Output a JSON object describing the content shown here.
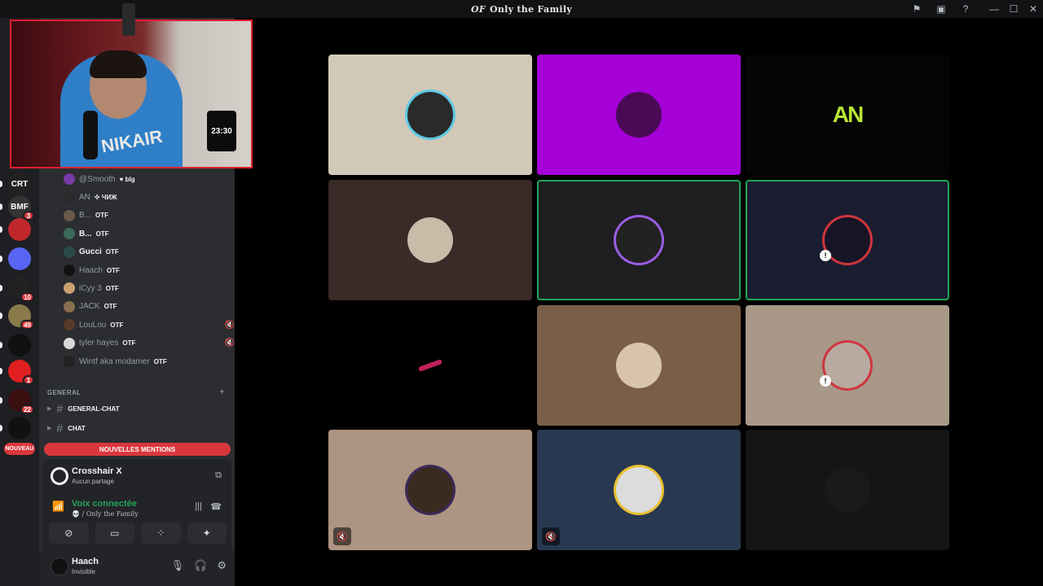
{
  "window": {
    "title": "Only the Family",
    "title_logo": "OF"
  },
  "colors": {
    "accent_red": "#da373c",
    "voice_green": "#23a559",
    "sidebar_bg": "#2b2d31"
  },
  "rail": {
    "servers": [
      {
        "label": "CRT",
        "badge": ""
      },
      {
        "label": "BMF",
        "badge": "3"
      },
      {
        "label": "",
        "badge": ""
      },
      {
        "label": "",
        "badge": ""
      },
      {
        "label": "",
        "badge": "10"
      },
      {
        "label": "",
        "badge": "49"
      },
      {
        "label": "",
        "badge": ""
      },
      {
        "label": "",
        "badge": "1"
      },
      {
        "label": "",
        "badge": "22"
      },
      {
        "label": "",
        "badge": ""
      }
    ]
  },
  "members": [
    {
      "name": "@Smooth",
      "tag": "♥ blg",
      "white": false,
      "muted": false
    },
    {
      "name": "AN",
      "tag": "✜ ЧИЖ",
      "white": false,
      "muted": false
    },
    {
      "name": "B...",
      "tag": "OTF",
      "white": false,
      "muted": false
    },
    {
      "name": "B...",
      "tag": "OTF",
      "white": true,
      "muted": false
    },
    {
      "name": "Gucci",
      "tag": "OTF",
      "white": true,
      "muted": false
    },
    {
      "name": "Haach",
      "tag": "OTF",
      "white": false,
      "muted": false
    },
    {
      "name": "iCyy 3",
      "tag": "OTF",
      "white": false,
      "muted": false
    },
    {
      "name": "JACK",
      "tag": "OTF",
      "white": false,
      "muted": false
    },
    {
      "name": "LouLou",
      "tag": "OTF",
      "white": false,
      "muted": true
    },
    {
      "name": "tyler hayes",
      "tag": "OTF",
      "white": false,
      "muted": true
    },
    {
      "name": "Wintf aka modamer",
      "tag": "OTF",
      "white": false,
      "muted": false
    }
  ],
  "category": {
    "label": "GENERAL",
    "plus": "+"
  },
  "channels": [
    {
      "name": "GENERAL-CHAT"
    },
    {
      "name": "CHAT"
    }
  ],
  "new_pill": "NOUVEAU",
  "mentions_bar": "NOUVELLES MENTIONS",
  "activity": {
    "title": "Crosshair X",
    "subtitle": "Aucun partage"
  },
  "voice": {
    "status": "Voix connectée",
    "channel": "💀 / Only the Family"
  },
  "user": {
    "name": "Haach",
    "status": "Invisible"
  },
  "webcam": {
    "hoodie_text": "NIKAIR",
    "clock": "23:30"
  },
  "tiles": [
    {
      "bg": "#d2c8b8",
      "speaking": false,
      "muted": false,
      "pfp": "#2a2a2a",
      "ring": "#5ecbe6",
      "alert": false,
      "text": ""
    },
    {
      "bg": "#a500d8",
      "speaking": false,
      "muted": false,
      "pfp": "#4a0a55",
      "ring": "",
      "alert": false,
      "text": ""
    },
    {
      "bg": "#050505",
      "speaking": false,
      "muted": false,
      "pfp": "",
      "ring": "",
      "alert": false,
      "text": "AN"
    },
    {
      "bg": "#3a2a28",
      "speaking": false,
      "muted": false,
      "pfp": "#c9bba8",
      "ring": "",
      "alert": false,
      "text": ""
    },
    {
      "bg": "#1d1e1f",
      "speaking": true,
      "muted": false,
      "pfp": "#222",
      "ring": "#9b5de5",
      "alert": false,
      "text": ""
    },
    {
      "bg": "#1a1d30",
      "speaking": true,
      "muted": false,
      "pfp": "#151525",
      "ring": "#d0353f",
      "alert": true,
      "text": ""
    },
    {
      "bg": "#000000",
      "speaking": false,
      "muted": false,
      "pfp": "",
      "ring": "",
      "alert": false,
      "text": ""
    },
    {
      "bg": "#7a5e48",
      "speaking": false,
      "muted": false,
      "pfp": "#d8c4a8",
      "ring": "",
      "alert": false,
      "text": ""
    },
    {
      "bg": "#a99888",
      "speaking": false,
      "muted": false,
      "pfp": "#b8aaa0",
      "ring": "#d0353f",
      "alert": true,
      "text": ""
    },
    {
      "bg": "#ae9482",
      "speaking": false,
      "muted": true,
      "pfp": "#3a2a20",
      "ring": "#3b2a5a",
      "alert": false,
      "text": ""
    },
    {
      "bg": "#283850",
      "speaking": false,
      "muted": true,
      "pfp": "#dcdcdc",
      "ring": "#e9c030",
      "alert": false,
      "text": ""
    },
    {
      "bg": "#141514",
      "speaking": false,
      "muted": false,
      "pfp": "#1a1a1a",
      "ring": "",
      "alert": false,
      "text": ""
    }
  ]
}
